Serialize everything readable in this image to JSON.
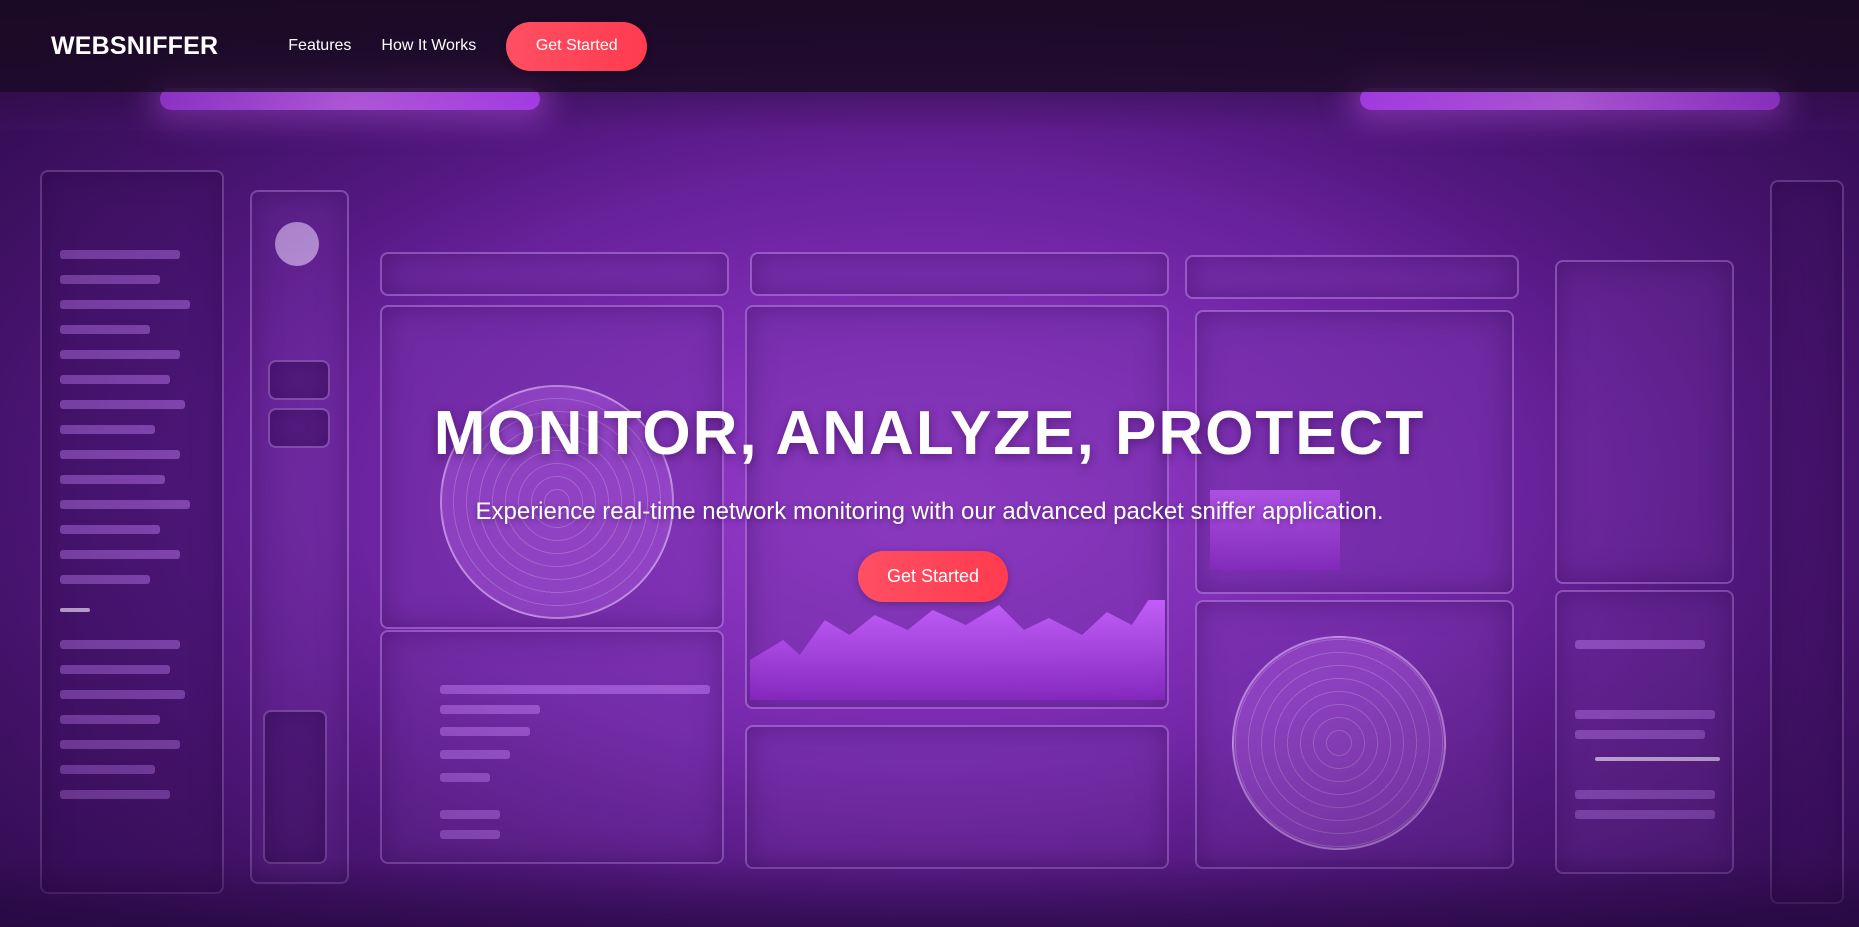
{
  "navbar": {
    "brand": "WEBSNIFFER",
    "links": [
      {
        "label": "Features"
      },
      {
        "label": "How It Works"
      }
    ],
    "cta_label": "Get Started"
  },
  "hero": {
    "title": "MONITOR, ANALYZE, PROTECT",
    "subtitle": "Experience real-time network monitoring with our advanced packet sniffer application.",
    "cta_label": "Get Started"
  },
  "colors": {
    "accent": "#ff4658",
    "background": "#7a2bb0",
    "navbar": "#190a23"
  }
}
